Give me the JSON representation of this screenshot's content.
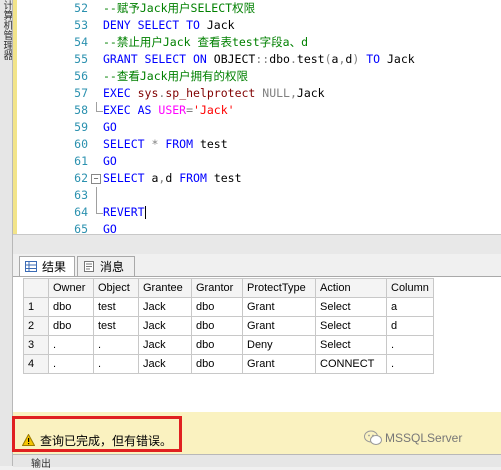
{
  "sidebar_label": "计算机管理器",
  "editor_lines": [
    {
      "n": "52",
      "fold": "none",
      "parts": [
        [
          "cm",
          "--赋予Jack用户SELECT权限"
        ]
      ]
    },
    {
      "n": "53",
      "fold": "none",
      "parts": [
        [
          "kw",
          "DENY SELECT TO "
        ],
        [
          "id",
          "Jack"
        ]
      ]
    },
    {
      "n": "54",
      "fold": "none",
      "parts": [
        [
          "cm",
          "--禁止用户Jack 查看表test字段a、d"
        ]
      ]
    },
    {
      "n": "55",
      "fold": "none",
      "parts": [
        [
          "kw",
          "GRANT SELECT ON "
        ],
        [
          "id",
          "OBJECT"
        ],
        [
          "gr",
          "::"
        ],
        [
          "id",
          "dbo"
        ],
        [
          "gr",
          "."
        ],
        [
          "id",
          "test"
        ],
        [
          "gr",
          "("
        ],
        [
          "id",
          "a"
        ],
        [
          "gr",
          ","
        ],
        [
          "id",
          "d"
        ],
        [
          "gr",
          ")"
        ],
        [
          "kw",
          " TO "
        ],
        [
          "id",
          "Jack"
        ]
      ]
    },
    {
      "n": "56",
      "fold": "none",
      "parts": [
        [
          "cm",
          "--查看Jack用户拥有的权限"
        ]
      ]
    },
    {
      "n": "57",
      "fold": "none",
      "parts": [
        [
          "kw",
          "EXEC "
        ],
        [
          "sp",
          "sys"
        ],
        [
          "gr",
          "."
        ],
        [
          "sp",
          "sp_helprotect "
        ],
        [
          "gr",
          "NULL,"
        ],
        [
          "id",
          "Jack"
        ]
      ]
    },
    {
      "n": "58",
      "fold": "end",
      "parts": [
        [
          "kw",
          "EXEC AS "
        ],
        [
          "fn",
          "USER"
        ],
        [
          "gr",
          "="
        ],
        [
          "st",
          "'Jack'"
        ]
      ]
    },
    {
      "n": "59",
      "fold": "none",
      "parts": [
        [
          "kw",
          "GO"
        ]
      ]
    },
    {
      "n": "60",
      "fold": "none",
      "parts": [
        [
          "kw",
          "SELECT "
        ],
        [
          "gr",
          "* "
        ],
        [
          "kw",
          "FROM "
        ],
        [
          "id",
          "test"
        ]
      ]
    },
    {
      "n": "61",
      "fold": "none",
      "parts": [
        [
          "kw",
          "GO"
        ]
      ]
    },
    {
      "n": "62",
      "fold": "start",
      "parts": [
        [
          "kw",
          "SELECT "
        ],
        [
          "id",
          "a"
        ],
        [
          "gr",
          ","
        ],
        [
          "id",
          "d "
        ],
        [
          "kw",
          "FROM "
        ],
        [
          "id",
          "test"
        ]
      ]
    },
    {
      "n": "63",
      "fold": "line",
      "parts": []
    },
    {
      "n": "64",
      "fold": "end",
      "parts": [
        [
          "kw",
          "REVERT"
        ]
      ]
    },
    {
      "n": "65",
      "fold": "none",
      "parts": [
        [
          "kw",
          "GO"
        ]
      ]
    }
  ],
  "tabs": [
    {
      "label": "结果",
      "icon": "grid-icon",
      "active": true
    },
    {
      "label": "消息",
      "icon": "message-icon",
      "active": false
    }
  ],
  "grid": {
    "columns": [
      "Owner",
      "Object",
      "Grantee",
      "Grantor",
      "ProtectType",
      "Action",
      "Column"
    ],
    "rows": [
      [
        "1",
        "dbo",
        "test",
        "Jack",
        "dbo",
        "Grant",
        "Select",
        "a"
      ],
      [
        "2",
        "dbo",
        "test",
        "Jack",
        "dbo",
        "Grant",
        "Select",
        "d"
      ],
      [
        "3",
        ".",
        ".",
        "Jack",
        "dbo",
        "Deny",
        "Select",
        "."
      ],
      [
        "4",
        ".",
        ".",
        "Jack",
        "dbo",
        "Grant",
        "CONNECT",
        "."
      ]
    ]
  },
  "status": {
    "text": "查询已完成，但有错误。",
    "icon": "warning-icon",
    "watermark": "MSSQLServer"
  },
  "bottom_tab": "输出"
}
